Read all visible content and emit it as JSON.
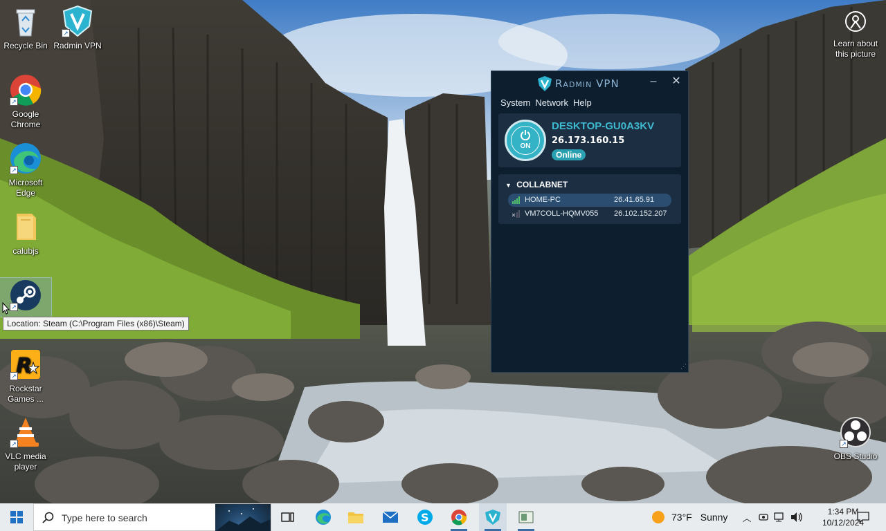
{
  "desktop": {
    "icons": [
      {
        "label": "Recycle Bin",
        "icon": "recycle-bin-icon"
      },
      {
        "label": "Radmin VPN",
        "icon": "radmin-vpn-icon"
      },
      {
        "label": "Google Chrome",
        "icon": "chrome-icon"
      },
      {
        "label": "Microsoft Edge",
        "icon": "edge-icon"
      },
      {
        "label": "calubjs",
        "icon": "folder-icon"
      },
      {
        "label": "Steam",
        "icon": "steam-icon"
      },
      {
        "label": "Rockstar Games ...",
        "icon": "rockstar-icon"
      },
      {
        "label": "VLC media player",
        "icon": "vlc-icon"
      },
      {
        "label": "Learn about this picture",
        "icon": "location-icon"
      },
      {
        "label": "OBS Studio",
        "icon": "obs-icon"
      }
    ],
    "tooltip": "Location: Steam (C:\\Program Files (x86)\\Steam)"
  },
  "radmin": {
    "title": "Radmin VPN",
    "menu": [
      "System",
      "Network",
      "Help"
    ],
    "power_label": "ON",
    "hostname": "DESKTOP-GU0A3KV",
    "ip": "26.173.160.15",
    "status": "Online",
    "network": {
      "name": "COLLABNET",
      "peers": [
        {
          "name": "HOME-PC",
          "ip": "26.41.65.91",
          "online": true
        },
        {
          "name": "VM7COLL-HQMV055",
          "ip": "26.102.152.207",
          "online": false
        }
      ]
    },
    "colors": {
      "accent": "#3fb9cf",
      "bg": "#0d1e2e",
      "panel": "#1c2f42"
    }
  },
  "taskbar": {
    "search_placeholder": "Type here to search",
    "apps": [
      "task-view-icon",
      "edge-icon",
      "file-explorer-icon",
      "mail-icon",
      "skype-icon",
      "chrome-icon",
      "radmin-vpn-icon",
      "generic-app-icon"
    ],
    "weather": {
      "temp": "73°F",
      "condition": "Sunny"
    },
    "time": "1:34 PM",
    "date": "10/12/2024"
  }
}
